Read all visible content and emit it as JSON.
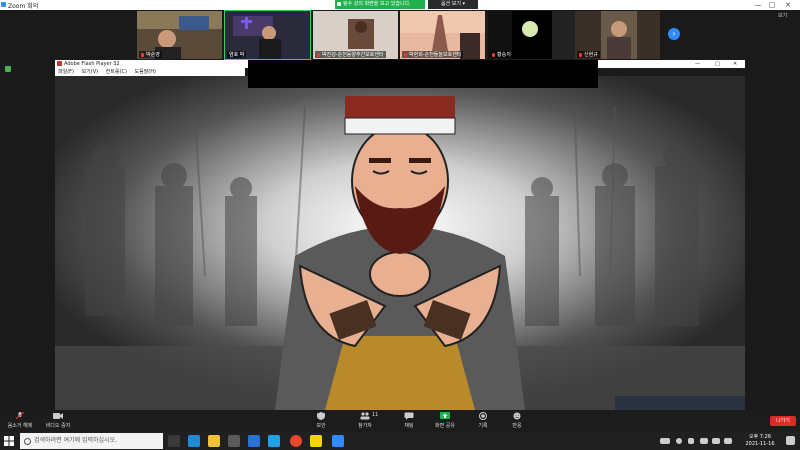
{
  "window": {
    "title": "Zoom 회의",
    "minimize": "—",
    "maximize": "□",
    "close": "✕"
  },
  "share": {
    "banner": "링수 강의 화면을 보고 있습니다.",
    "view_options": "옵션 보기 ▾",
    "view_label": "보기"
  },
  "participants": [
    {
      "name": "박순영",
      "muted": true
    },
    {
      "name": "염호 박",
      "muted": false
    },
    {
      "name": "박진성-순천동양주간보호센터",
      "muted": true
    },
    {
      "name": "박현희-순천들놀보호센터",
      "muted": true
    },
    {
      "name": "황승지",
      "muted": true
    },
    {
      "name": "",
      "muted": false
    },
    {
      "name": "신현규",
      "muted": true
    }
  ],
  "flash_player": {
    "title": "Adobe Flash Player 32",
    "menu": [
      "파일(F)",
      "보기(V)",
      "컨트롤(C)",
      "도움말(H)"
    ]
  },
  "toolbar": [
    {
      "label": "음소거 해제",
      "icon": "mic-muted-icon"
    },
    {
      "label": "비디오 중지",
      "icon": "video-icon"
    },
    {
      "label": "보안",
      "icon": "shield-icon"
    },
    {
      "label": "참가자",
      "icon": "participants-icon",
      "count": "11"
    },
    {
      "label": "채팅",
      "icon": "chat-icon"
    },
    {
      "label": "화면 공유",
      "icon": "share-screen-icon"
    },
    {
      "label": "기록",
      "icon": "record-icon"
    },
    {
      "label": "반응",
      "icon": "reaction-icon"
    }
  ],
  "leave_label": "나가기",
  "taskbar": {
    "search_placeholder": "검색하려면 여기에 입력하십시오.",
    "time": "오후 7:26",
    "date": "2021-11-16"
  },
  "colors": {
    "accent": "#2d8cff",
    "share_green": "#23b14d",
    "leave_red": "#e02828"
  }
}
